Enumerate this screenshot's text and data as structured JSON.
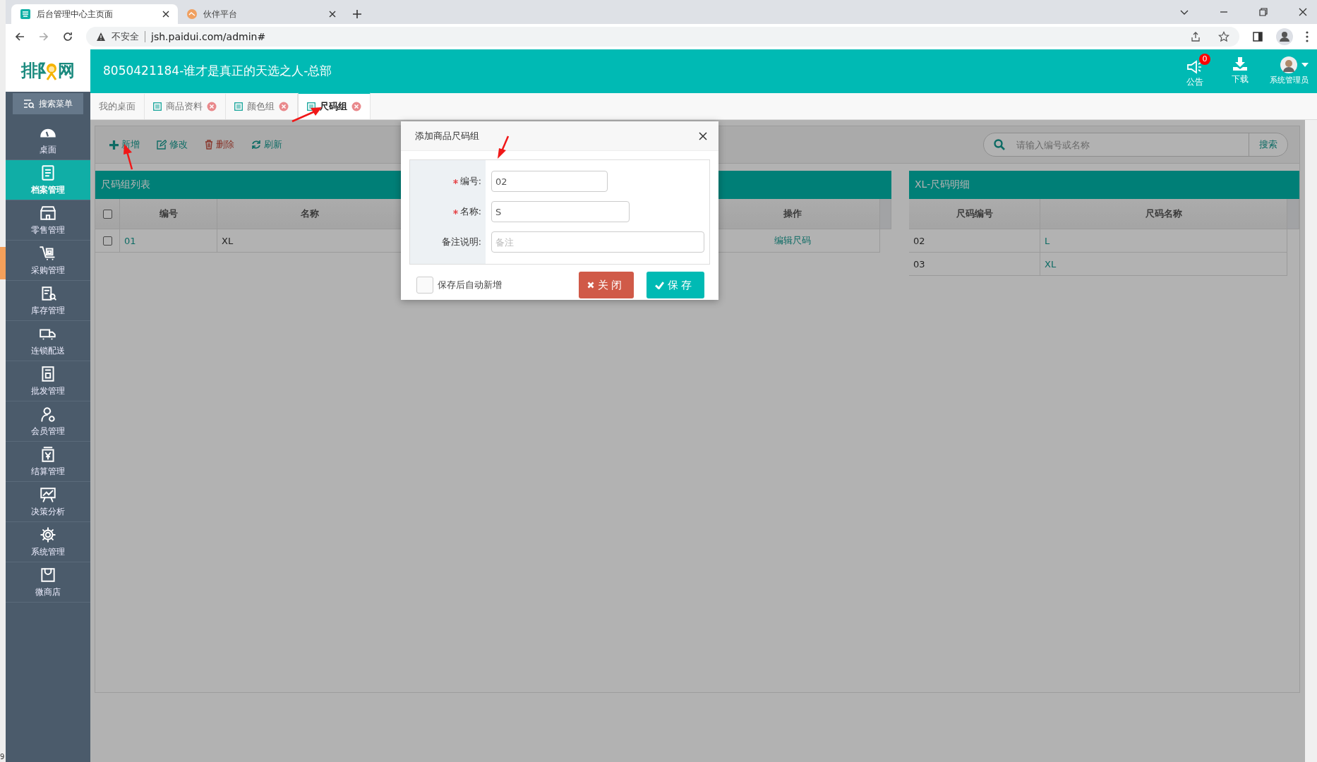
{
  "browser": {
    "tabs": [
      {
        "title": "后台管理中心主页面",
        "selected": true
      },
      {
        "title": "伙伴平台",
        "selected": false
      }
    ],
    "security": "不安全",
    "url": "jsh.paidui.com/admin#"
  },
  "header": {
    "logo": [
      "排",
      "网"
    ],
    "title": "8050421184-谁才是真正的天选之人-总部",
    "notice": {
      "label": "公告",
      "badge": "0"
    },
    "download": "下载",
    "user": "系统管理员"
  },
  "sidebar": {
    "search": "搜索菜单",
    "items": [
      {
        "label": "桌面",
        "selected": false
      },
      {
        "label": "档案管理",
        "selected": true
      },
      {
        "label": "零售管理",
        "selected": false
      },
      {
        "label": "采购管理",
        "selected": false
      },
      {
        "label": "库存管理",
        "selected": false
      },
      {
        "label": "连锁配送",
        "selected": false
      },
      {
        "label": "批发管理",
        "selected": false
      },
      {
        "label": "会员管理",
        "selected": false
      },
      {
        "label": "结算管理",
        "selected": false
      },
      {
        "label": "决策分析",
        "selected": false
      },
      {
        "label": "系统管理",
        "selected": false
      },
      {
        "label": "微商店",
        "selected": false
      }
    ]
  },
  "tabs": [
    {
      "label": "我的桌面",
      "kind": "home",
      "selected": false
    },
    {
      "label": "商品资料",
      "kind": "page",
      "selected": false
    },
    {
      "label": "颜色组",
      "kind": "page",
      "selected": false
    },
    {
      "label": "尺码组",
      "kind": "page",
      "selected": true
    }
  ],
  "toolbar": [
    {
      "label": "新增",
      "kind": "add"
    },
    {
      "label": "修改",
      "kind": "edit"
    },
    {
      "label": "删除",
      "kind": "delete"
    },
    {
      "label": "刷新",
      "kind": "refresh"
    }
  ],
  "search": {
    "placeholder": "请输入编号或名称",
    "button": "搜索"
  },
  "size_groups": {
    "title": "尺码组列表",
    "select_all_checked": false,
    "columns": [
      "编号",
      "名称",
      "操作"
    ],
    "rows": [
      {
        "checked": false,
        "cells": [
          "01",
          "XL",
          "编辑尺码"
        ]
      }
    ]
  },
  "detail": {
    "title": "XL-尺码明细",
    "columns": [
      "尺码编号",
      "尺码名称"
    ],
    "rows": [
      [
        "02",
        "L"
      ],
      [
        "03",
        "XL"
      ]
    ]
  },
  "dialog": {
    "title": "添加商品尺码组",
    "fields": [
      {
        "label": "编号:",
        "required": true,
        "value": "02"
      },
      {
        "label": "名称:",
        "required": true,
        "value": "S"
      },
      {
        "label": "备注说明:",
        "required": false,
        "placeholder": "备注"
      }
    ],
    "auto_new": {
      "label": "保存后自动新增",
      "checked": false
    },
    "buttons": [
      {
        "label": "关闭",
        "kind": "close"
      },
      {
        "label": "保存",
        "kind": "save"
      }
    ]
  },
  "edge_text": "9"
}
